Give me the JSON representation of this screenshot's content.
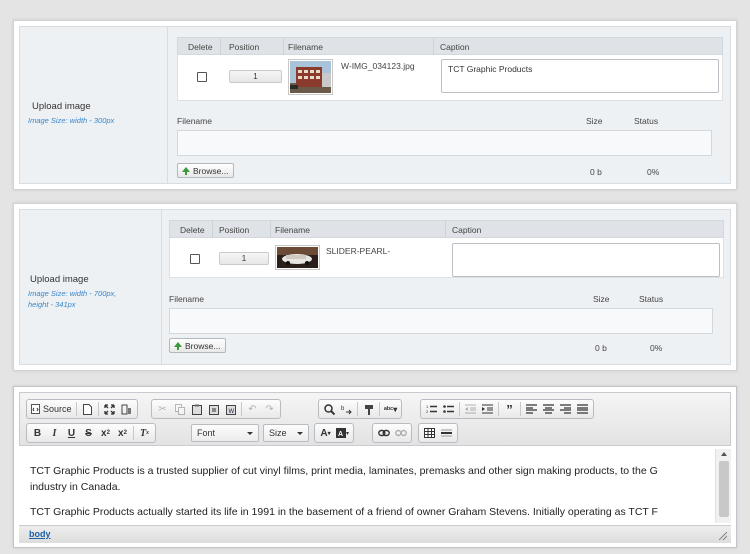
{
  "upload1": {
    "label": "Upload image",
    "hint": "Image Size: width - 300px",
    "columns": {
      "delete": "Delete",
      "position": "Position",
      "filename": "Filename",
      "caption": "Caption"
    },
    "row": {
      "position": "1",
      "filename": "W-IMG_034123.jpg",
      "caption": "TCT Graphic Products"
    },
    "queue_columns": {
      "filename": "Filename",
      "size": "Size",
      "status": "Status"
    },
    "browse_label": "Browse...",
    "size_value": "0 b",
    "status_value": "0%"
  },
  "upload2": {
    "label": "Upload image",
    "hint_line1": "Image Size: width - 700px,",
    "hint_line2": "height - 341px",
    "columns": {
      "delete": "Delete",
      "position": "Position",
      "filename": "Filename",
      "caption": "Caption"
    },
    "row": {
      "position": "1",
      "filename": "SLIDER-PEARL-",
      "caption": ""
    },
    "queue_columns": {
      "filename": "Filename",
      "size": "Size",
      "status": "Status"
    },
    "browse_label": "Browse...",
    "size_value": "0 b",
    "status_value": "0%"
  },
  "editor": {
    "toolbar": {
      "source_label": "Source",
      "font_label": "Font",
      "size_label": "Size"
    },
    "paragraphs": [
      "TCT Graphic Products is a trusted supplier of cut vinyl films, print media, laminates, premasks and other sign making products, to the G",
      "industry in Canada.",
      "TCT Graphic Products actually started its life in 1991 in the basement of a friend of owner Graham Stevens.  Initially operating as TCT F"
    ],
    "path": "body"
  },
  "colors": {
    "hint": "#3a86c8",
    "path_link": "#1d5fa8",
    "panel_bg": "#eef1f4"
  }
}
